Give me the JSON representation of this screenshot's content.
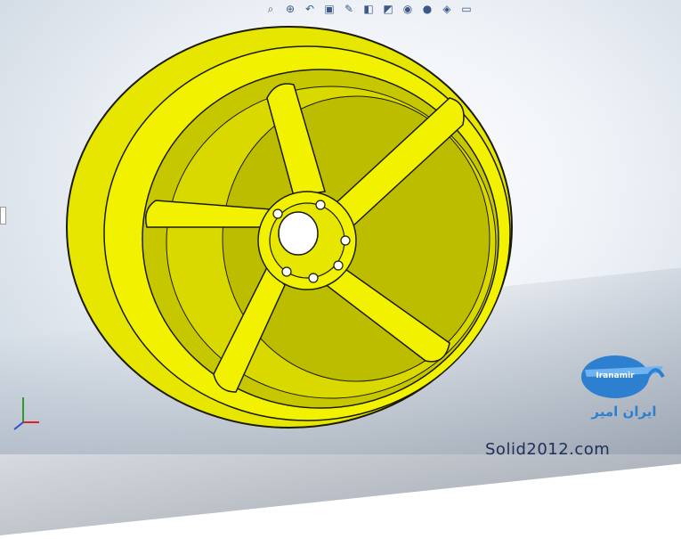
{
  "toolbar": {
    "icons": [
      "zoom-to-fit-icon",
      "zoom-area-icon",
      "previous-view-icon",
      "section-view-icon",
      "dynamic-annotation-icon",
      "view-orientation-icon",
      "display-style-icon",
      "hide-show-icon",
      "edit-appearance-icon",
      "apply-scene-icon",
      "view-settings-icon"
    ]
  },
  "colors": {
    "wheel": "#f2f200",
    "wheel_shade": "#b9b900",
    "edge": "#1a1a00",
    "logo": "#2d7fd0"
  },
  "logo": {
    "name_en": "Iranamir",
    "name_fa": "ایران امیر"
  },
  "watermark": "Solid2012.com"
}
